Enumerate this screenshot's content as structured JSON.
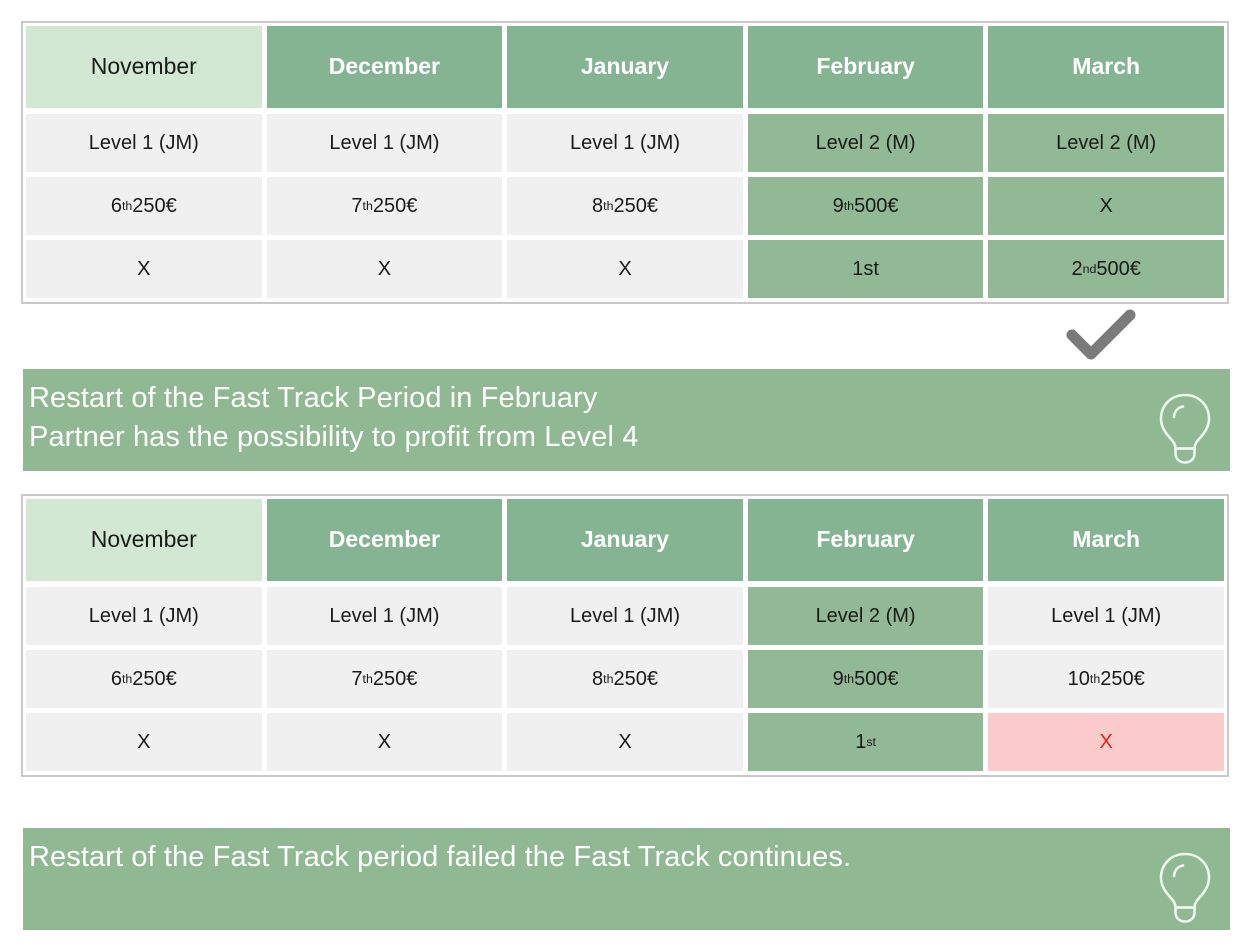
{
  "colors": {
    "header_light_green": "#d3e8d2",
    "header_dark_green": "#84b492",
    "cell_grey": "#f0f0f0",
    "cell_green": "#92b995",
    "cell_red_bg": "#fccccc",
    "cell_red_text": "#e8201e",
    "banner_green": "#8fb893",
    "check_grey": "#7a7a7a",
    "table_border": "#c9c9c9"
  },
  "table1": {
    "headers": [
      {
        "label": "November",
        "style": "light"
      },
      {
        "label": "December",
        "style": "dark"
      },
      {
        "label": "January",
        "style": "dark"
      },
      {
        "label": "February",
        "style": "dark"
      },
      {
        "label": "March",
        "style": "dark"
      }
    ],
    "rows": [
      {
        "cells": [
          {
            "text": "Level 1 (JM)",
            "style": "grey"
          },
          {
            "text": "Level 1 (JM)",
            "style": "grey"
          },
          {
            "text": "Level 1 (JM)",
            "style": "grey"
          },
          {
            "text": "Level 2 (M)",
            "style": "green"
          },
          {
            "text": "Level 2 (M)",
            "style": "green"
          }
        ]
      },
      {
        "cells": [
          {
            "text": "6",
            "sup": "th",
            "suffix": " 250€",
            "style": "grey"
          },
          {
            "text": "7",
            "sup": "th",
            "suffix": " 250€",
            "style": "grey"
          },
          {
            "text": "8",
            "sup": "th",
            "suffix": " 250€",
            "style": "grey"
          },
          {
            "text": "9",
            "sup": "th",
            "suffix": " 500€",
            "style": "green"
          },
          {
            "text": "X",
            "style": "green"
          }
        ]
      },
      {
        "cells": [
          {
            "text": "X",
            "style": "grey"
          },
          {
            "text": "X",
            "style": "grey"
          },
          {
            "text": "X",
            "style": "grey"
          },
          {
            "text": "1st",
            "style": "green"
          },
          {
            "text": "2",
            "sup": "nd",
            "suffix": " 500€",
            "style": "green"
          }
        ]
      }
    ]
  },
  "checkmark": {
    "icon": "check-mark-icon"
  },
  "banner1": {
    "text": "Restart of the Fast Track Period in February\nPartner has the possibility to profit from Level 4",
    "icon": "lightbulb-icon"
  },
  "table2": {
    "headers": [
      {
        "label": "November",
        "style": "light"
      },
      {
        "label": "December",
        "style": "dark"
      },
      {
        "label": "January",
        "style": "dark"
      },
      {
        "label": "February",
        "style": "dark"
      },
      {
        "label": "March",
        "style": "dark"
      }
    ],
    "rows": [
      {
        "cells": [
          {
            "text": "Level 1 (JM)",
            "style": "grey"
          },
          {
            "text": "Level 1 (JM)",
            "style": "grey"
          },
          {
            "text": "Level 1 (JM)",
            "style": "grey"
          },
          {
            "text": "Level 2 (M)",
            "style": "green"
          },
          {
            "text": "Level 1 (JM)",
            "style": "grey"
          }
        ]
      },
      {
        "cells": [
          {
            "text": "6",
            "sup": "th",
            "suffix": " 250€",
            "style": "grey"
          },
          {
            "text": "7",
            "sup": "th",
            "suffix": " 250€",
            "style": "grey"
          },
          {
            "text": "8",
            "sup": "th",
            "suffix": " 250€",
            "style": "grey"
          },
          {
            "text": "9",
            "sup": "th",
            "suffix": " 500€",
            "style": "green"
          },
          {
            "text": "10",
            "sup": "th",
            "suffix": " 250€",
            "style": "grey"
          }
        ]
      },
      {
        "cells": [
          {
            "text": "X",
            "style": "grey"
          },
          {
            "text": "X",
            "style": "grey"
          },
          {
            "text": "X",
            "style": "grey"
          },
          {
            "text": "1",
            "sup": "st",
            "suffix": "",
            "style": "green"
          },
          {
            "text": "X",
            "style": "red"
          }
        ]
      }
    ]
  },
  "banner2": {
    "text": "Restart of the Fast Track period failed the Fast Track continues.",
    "icon": "lightbulb-icon"
  }
}
